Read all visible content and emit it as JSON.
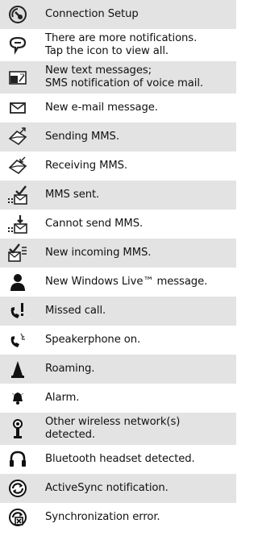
{
  "status_icons": [
    {
      "icon": "connection-setup-icon",
      "text": "Connection Setup"
    },
    {
      "icon": "more-notifications-icon",
      "text": "There are more notifications.\nTap the icon to view all."
    },
    {
      "icon": "text-message-icon",
      "text": "New text messages;\nSMS notification of voice mail."
    },
    {
      "icon": "email-icon",
      "text": "New e-mail message."
    },
    {
      "icon": "sending-mms-icon",
      "text": "Sending MMS."
    },
    {
      "icon": "receiving-mms-icon",
      "text": "Receiving MMS."
    },
    {
      "icon": "mms-sent-icon",
      "text": "MMS sent."
    },
    {
      "icon": "mms-send-failed-icon",
      "text": "Cannot send MMS."
    },
    {
      "icon": "incoming-mms-icon",
      "text": "New incoming MMS."
    },
    {
      "icon": "windows-live-message-icon",
      "text": "New Windows Live™ message."
    },
    {
      "icon": "missed-call-icon",
      "text": "Missed call."
    },
    {
      "icon": "speakerphone-icon",
      "text": "Speakerphone on."
    },
    {
      "icon": "roaming-icon",
      "text": "Roaming."
    },
    {
      "icon": "alarm-icon",
      "text": "Alarm."
    },
    {
      "icon": "wireless-network-icon",
      "text": "Other wireless network(s)\ndetected."
    },
    {
      "icon": "bluetooth-headset-icon",
      "text": "Bluetooth headset detected."
    },
    {
      "icon": "activesync-icon",
      "text": "ActiveSync notification."
    },
    {
      "icon": "sync-error-icon",
      "text": "Synchronization error."
    }
  ]
}
